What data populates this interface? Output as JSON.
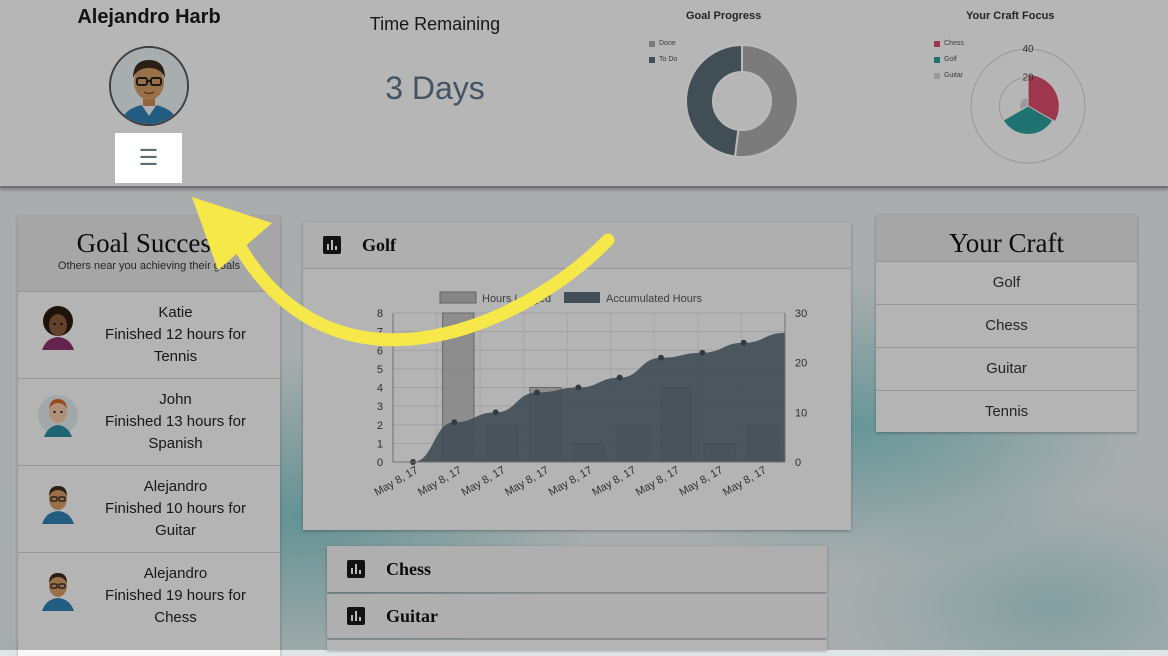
{
  "header": {
    "user_name": "Alejandro Harb",
    "time_label": "Time Remaining",
    "time_value": "3 Days",
    "goal_progress": {
      "title": "Goal Progress",
      "legend": [
        {
          "label": "Done",
          "color": "#a9a9a9"
        },
        {
          "label": "To Do",
          "color": "#5b6b76"
        }
      ]
    },
    "craft_focus": {
      "title": "Your Craft Focus",
      "legend": [
        {
          "label": "Chess",
          "color": "#d94a6a"
        },
        {
          "label": "Golf",
          "color": "#2a9d9a"
        },
        {
          "label": "Guitar",
          "color": "#d5d5d5"
        }
      ],
      "ticks": [
        "40",
        "20"
      ]
    }
  },
  "goal_success": {
    "title": "Goal Success",
    "subtitle": "Others near you achieving their goals",
    "people": [
      {
        "name": "Katie",
        "line1": "Finished 12 hours for",
        "line2": "Tennis"
      },
      {
        "name": "John",
        "line1": "Finished 13 hours for",
        "line2": "Spanish"
      },
      {
        "name": "Alejandro",
        "line1": "Finished 10 hours for",
        "line2": "Guitar"
      },
      {
        "name": "Alejandro",
        "line1": "Finished 19 hours for",
        "line2": "Chess"
      }
    ]
  },
  "panels": {
    "golf": "Golf",
    "chess": "Chess",
    "guitar": "Guitar"
  },
  "your_craft": {
    "title": "Your Craft",
    "items": [
      "Golf",
      "Chess",
      "Guitar",
      "Tennis"
    ]
  },
  "chart_data": [
    {
      "type": "bar",
      "title": "",
      "series": [
        {
          "name": "Hours Logged",
          "type": "bar",
          "axis": "left",
          "values": [
            0,
            8,
            2,
            4,
            1,
            2,
            4,
            1,
            2
          ]
        },
        {
          "name": "Accumulated Hours",
          "type": "area",
          "axis": "right",
          "values": [
            0,
            8,
            10,
            14,
            15,
            17,
            21,
            22,
            24,
            26
          ]
        }
      ],
      "x_tick_label": "May 8, 17",
      "x_tick_count": 9,
      "y_left_ticks": [
        "0",
        "1",
        "2",
        "3",
        "4",
        "5",
        "6",
        "7",
        "8"
      ],
      "y_right_ticks": [
        "0",
        "10",
        "20",
        "30"
      ],
      "ylim_left": [
        0,
        8
      ],
      "ylim_right": [
        0,
        30
      ],
      "colors": {
        "bars": "#b8b8b8",
        "area": "#5b6b78"
      },
      "grid": true,
      "legend": "top"
    },
    {
      "type": "pie",
      "title": "Goal Progress",
      "categories": [
        "Done",
        "To Do"
      ],
      "values": [
        52,
        48
      ]
    },
    {
      "type": "pie",
      "title": "Your Craft Focus",
      "categories": [
        "Chess",
        "Golf",
        "Guitar"
      ],
      "values": [
        22,
        20,
        6
      ],
      "rmax": 40
    }
  ]
}
